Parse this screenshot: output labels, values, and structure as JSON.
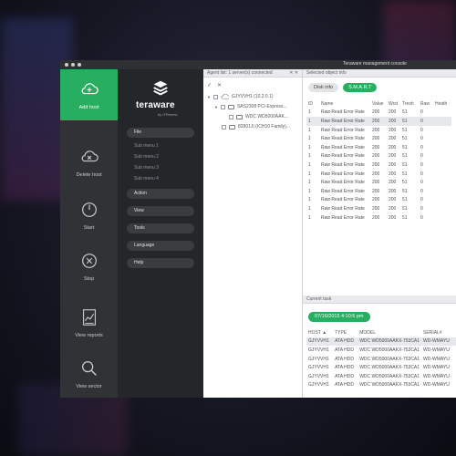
{
  "window": {
    "title": "Teraware management console"
  },
  "iconbar": {
    "items": [
      {
        "label": "Add host",
        "icon": "add-cloud-icon"
      },
      {
        "label": "Delete host",
        "icon": "delete-cloud-icon"
      },
      {
        "label": "Start",
        "icon": "power-icon"
      },
      {
        "label": "Stop",
        "icon": "stop-icon"
      },
      {
        "label": "View reports",
        "icon": "report-chart-icon"
      },
      {
        "label": "View sector",
        "icon": "magnifier-icon"
      }
    ],
    "active_color": "#27ae60"
  },
  "brand": {
    "name": "teraware",
    "sub": "by ITRenew"
  },
  "menu": {
    "file": "File",
    "submenus": [
      "Sub menu 1",
      "Sub menu 2",
      "Sub menu 3",
      "Sub menu 4"
    ],
    "action": "Action",
    "view": "View",
    "tools": "Tools",
    "language": "Language",
    "help": "Help"
  },
  "agents": {
    "header": "Agent list: 1 server(s) connected",
    "header_icons": "✕ ✕",
    "tree": [
      {
        "label": "GJYVVH1 (10.2.0.1)"
      },
      {
        "label": "SAS2308 PCI-Express..."
      },
      {
        "label": "WDC WD5000AAK..."
      },
      {
        "label": "82801JI (ICH10 Family)..."
      }
    ]
  },
  "selected": {
    "header": "Selected object info",
    "tab_disk": "Disk info",
    "tab_smart": "S.M.A.R.T",
    "columns": [
      "ID",
      "Name",
      "Value",
      "Wrst",
      "Tresh",
      "Raw",
      "Heath"
    ],
    "rows": [
      [
        "1",
        "Raw Read Error Rate",
        "200",
        "200",
        "51",
        "0",
        ""
      ],
      [
        "1",
        "Raw Read Error Rate",
        "200",
        "200",
        "51",
        "0",
        ""
      ],
      [
        "1",
        "Raw Read Error Rate",
        "200",
        "200",
        "51",
        "0",
        ""
      ],
      [
        "1",
        "Raw Read Error Rate",
        "200",
        "200",
        "51",
        "0",
        ""
      ],
      [
        "1",
        "Raw Read Error Rate",
        "200",
        "200",
        "51",
        "0",
        ""
      ],
      [
        "1",
        "Raw Read Error Rate",
        "200",
        "200",
        "51",
        "0",
        ""
      ],
      [
        "1",
        "Raw Read Error Rate",
        "200",
        "200",
        "51",
        "0",
        ""
      ],
      [
        "1",
        "Raw Read Error Rate",
        "200",
        "200",
        "51",
        "0",
        ""
      ],
      [
        "1",
        "Raw Read Error Rate",
        "200",
        "200",
        "51",
        "0",
        ""
      ],
      [
        "1",
        "Raw Read Error Rate",
        "200",
        "200",
        "51",
        "0",
        ""
      ],
      [
        "1",
        "Raw Read Error Rate",
        "200",
        "200",
        "51",
        "0",
        ""
      ],
      [
        "1",
        "Raw Read Error Rate",
        "200",
        "200",
        "51",
        "0",
        ""
      ],
      [
        "1",
        "Raw Read Error Rate",
        "200",
        "200",
        "51",
        "0",
        ""
      ]
    ]
  },
  "task": {
    "header": "Current task",
    "date": "07/16/2015 4:10:6 pm",
    "columns": [
      "HOST ▲",
      "TYPE",
      "MODEL",
      "SERIAL#"
    ],
    "rows": [
      [
        "GJYVVH1",
        "ATA HDD",
        "WDC WD5000AAKX-753CA1",
        "WD-WMAYU"
      ],
      [
        "GJYVVH1",
        "ATA HDD",
        "WDC WD5000AAKX-753CA1",
        "WD-WMAYU"
      ],
      [
        "GJYVVH1",
        "ATA HDD",
        "WDC WD5000AAKX-753CA1",
        "WD-WMAYU"
      ],
      [
        "GJYVVH1",
        "ATA HDD",
        "WDC WD5000AAKX-753CA1",
        "WD-WMAYU"
      ],
      [
        "GJYVVH1",
        "ATA HDD",
        "WDC WD5000AAKX-753CA1",
        "WD-WMAYU"
      ],
      [
        "GJYVVH1",
        "ATA HDD",
        "WDC WD5000AAKX-753CA1",
        "WD-WMAYU"
      ]
    ]
  }
}
